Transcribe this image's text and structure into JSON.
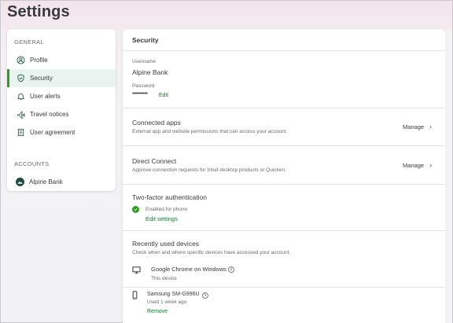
{
  "page": {
    "title": "Settings"
  },
  "sidebar": {
    "general_heading": "GENERAL",
    "items": [
      {
        "label": "Profile",
        "icon": "profile-icon"
      },
      {
        "label": "Security",
        "icon": "shield-icon",
        "active": true
      },
      {
        "label": "User alerts",
        "icon": "bell-icon"
      },
      {
        "label": "Travel notices",
        "icon": "airplane-icon"
      },
      {
        "label": "User agreement",
        "icon": "document-icon"
      }
    ],
    "accounts_heading": "ACCOUNTS",
    "accounts": [
      {
        "label": "Alpine Bank",
        "icon": "bank-avatar-icon"
      }
    ]
  },
  "security": {
    "title": "Security",
    "username_label": "Username",
    "username_value": "Alpine Bank",
    "password_label": "Password",
    "password_value": "••••••••••",
    "password_edit": "Edit",
    "connected_apps": {
      "title": "Connected apps",
      "desc": "External app and website permissions that can access your account.",
      "action": "Manage"
    },
    "direct_connect": {
      "title": "Direct Connect",
      "desc": "Approve connection requests for Intuit desktop products or Quicken.",
      "action": "Manage"
    },
    "two_factor": {
      "title": "Two-factor authentication",
      "status": "Enabled for phone",
      "action": "Edit settings"
    },
    "devices": {
      "title": "Recently used devices",
      "desc": "Check when and where specific devices have accessed your account.",
      "list": [
        {
          "name": "Google Chrome on Windows",
          "status": "This device",
          "icon": "desktop-icon"
        },
        {
          "name": "Samsung SM-G996U",
          "status": "Used 1 week ago",
          "action": "Remove",
          "icon": "phone-icon"
        }
      ]
    }
  },
  "colors": {
    "accent": "#2ca01c",
    "link": "#0d7a2f",
    "active_bg": "#e9f3ef"
  }
}
